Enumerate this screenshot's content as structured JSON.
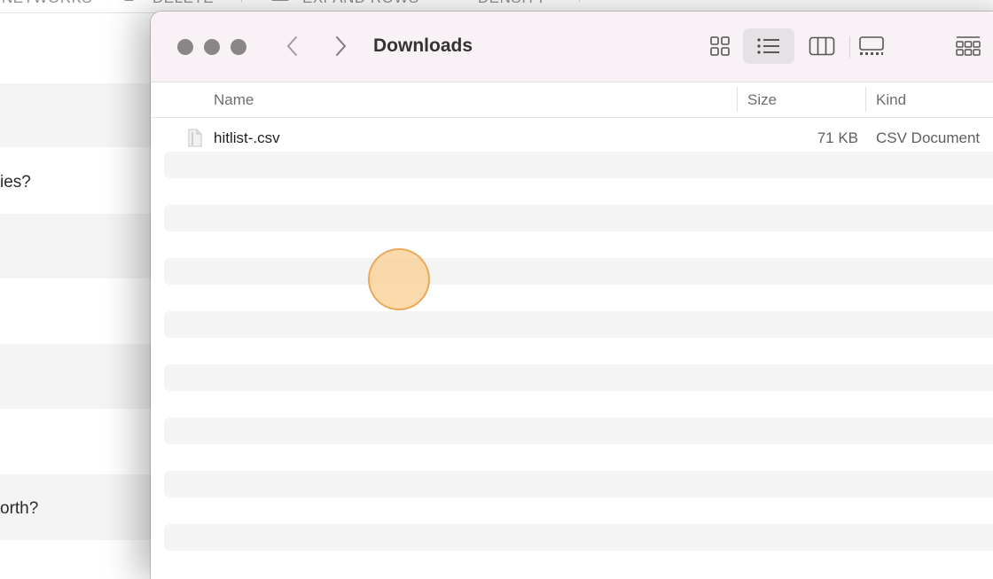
{
  "background_app": {
    "toolbar": {
      "networks_label": "NETWORKS",
      "delete_label": "DELETE",
      "expand_rows_label": "EXPAND ROWS",
      "density_label": "DENSITY"
    },
    "question_fragments": [
      "ies?",
      "orth?"
    ]
  },
  "finder": {
    "title": "Downloads",
    "columns": {
      "name": "Name",
      "size": "Size",
      "kind": "Kind"
    },
    "files": [
      {
        "name": "hitlist-.csv",
        "size": "71 KB",
        "kind": "CSV Document",
        "icon": "csv-file-icon"
      }
    ],
    "toolbar_icons": [
      "icon-view-icon",
      "list-view-icon",
      "column-view-icon",
      "gallery-view-icon",
      "group-icon"
    ],
    "active_view": "list"
  }
}
